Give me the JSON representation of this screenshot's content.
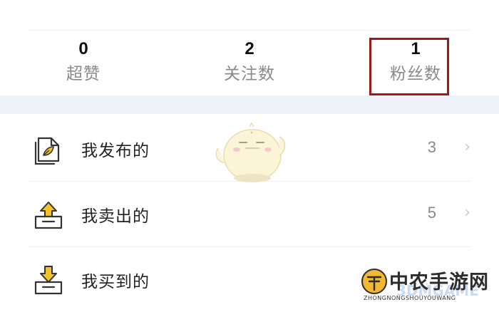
{
  "stats": [
    {
      "value": "0",
      "label": "超赞"
    },
    {
      "value": "2",
      "label": "关注数"
    },
    {
      "value": "1",
      "label": "粉丝数"
    }
  ],
  "menu": [
    {
      "label": "我发布的",
      "count": "3",
      "icon": "document-leaf-icon"
    },
    {
      "label": "我卖出的",
      "count": "5",
      "icon": "tray-upload-icon"
    },
    {
      "label": "我买到的",
      "count": "",
      "icon": "tray-download-icon"
    }
  ],
  "watermark": {
    "title": "中农手游网",
    "subtitle": "ZHONGNONGSHOUYOUWANG",
    "faint": "3DMGAME"
  },
  "colors": {
    "highlight_border": "#9b1b1b",
    "icon_yellow": "#f3c229",
    "band": "#eef2f8"
  }
}
